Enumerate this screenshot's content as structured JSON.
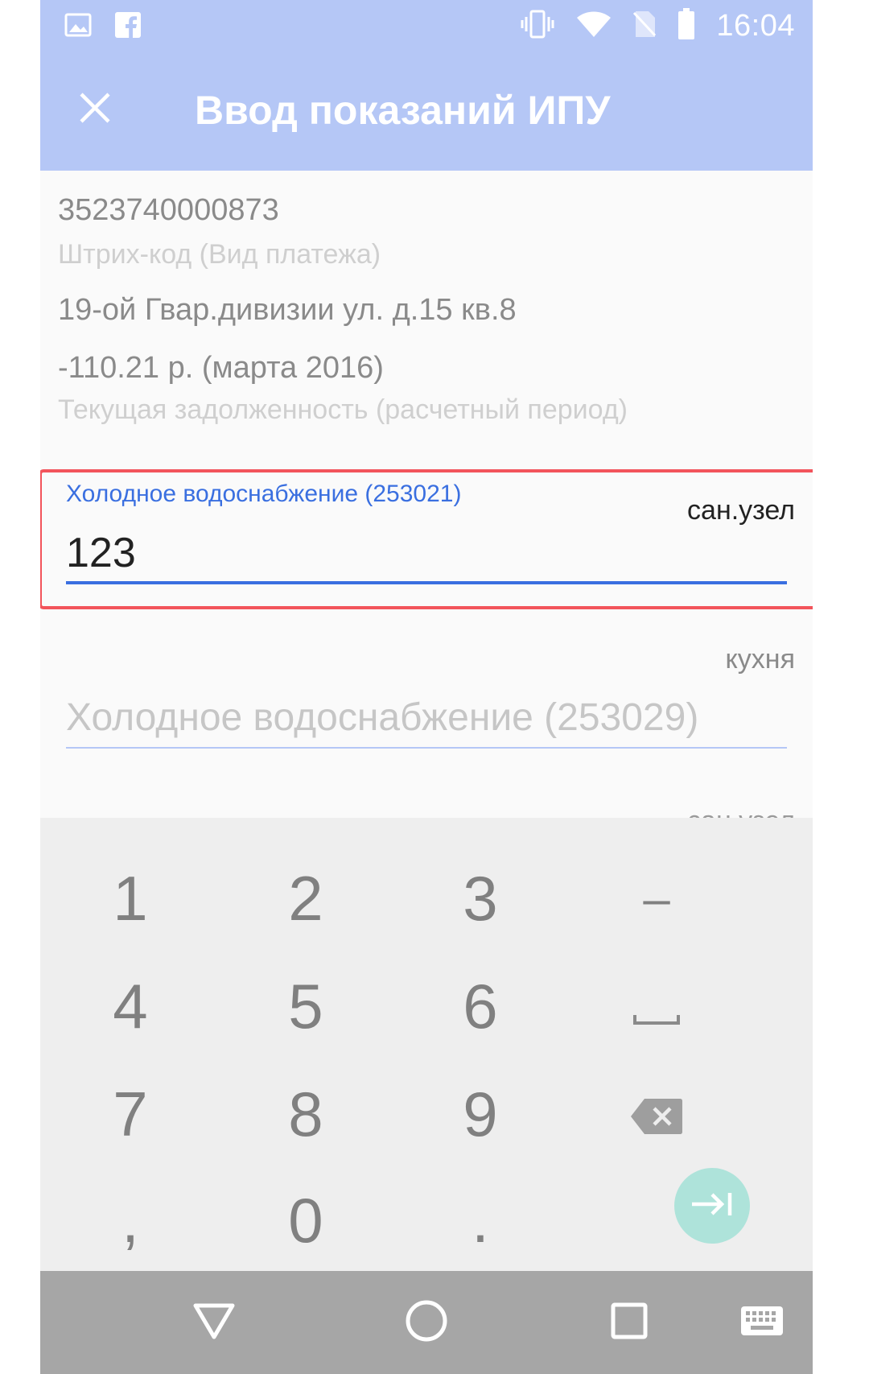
{
  "status_bar": {
    "time": "16:04",
    "left_icons": [
      "image-icon",
      "facebook-icon"
    ],
    "right_icons": [
      "vibrate-icon",
      "wifi-icon",
      "no-sim-icon",
      "battery-icon"
    ]
  },
  "app_bar": {
    "title": "Ввод показаний ИПУ",
    "close_icon": "close-icon"
  },
  "info": {
    "barcode_value": "3523740000873",
    "barcode_label": "Штрих-код (Вид платежа)",
    "address": "19-ой Гвар.дивизии ул. д.15 кв.8",
    "debt_value": "-110.21 р. (марта 2016)",
    "debt_label": "Текущая задолженность (расчетный период)"
  },
  "meters": [
    {
      "label": "Холодное водоснабжение (253021)",
      "location": "сан.узел",
      "value": "123"
    },
    {
      "placeholder": "Холодное водоснабжение (253029)",
      "location": "кухня",
      "value": ""
    },
    {
      "location": "сан.узел"
    }
  ],
  "keyboard": {
    "rows": [
      [
        "1",
        "2",
        "3",
        "–"
      ],
      [
        "4",
        "5",
        "6",
        "space"
      ],
      [
        "7",
        "8",
        "9",
        "backspace"
      ],
      [
        ",",
        "0",
        ".",
        "enter"
      ]
    ],
    "special_icons": {
      "space": "space-icon",
      "backspace": "backspace-icon",
      "enter": "tab-next-icon"
    },
    "enter_color": "#aee3da"
  },
  "nav_bar": {
    "buttons": [
      "back-icon",
      "home-icon",
      "recents-icon",
      "keyboard-icon"
    ]
  },
  "colors": {
    "app_bar": "#b5c7f6",
    "accent": "#3a6fe0",
    "highlight_border": "#f2545b",
    "nav_bar": "#a6a6a6"
  }
}
